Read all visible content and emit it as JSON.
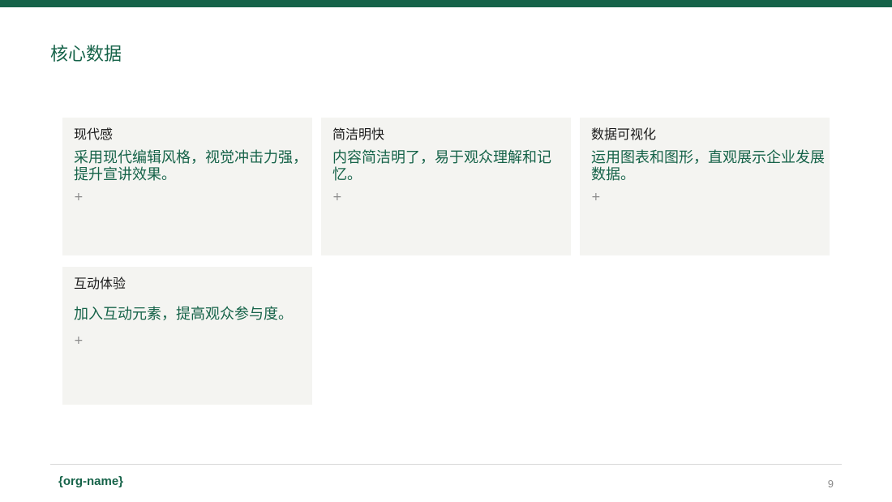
{
  "colors": {
    "accent": "#166349",
    "card_background": "#f4f4f1",
    "title_text": "#1a1a1a",
    "muted": "#8a8a8a"
  },
  "slide": {
    "title": "核心数据",
    "cards": [
      {
        "title": "现代感",
        "description": "采用现代编辑风格，视觉冲击力强，提升宣讲效果。",
        "add_icon": "plus-icon",
        "add_glyph": "+"
      },
      {
        "title": "简洁明快",
        "description": "内容简洁明了，易于观众理解和记忆。",
        "add_icon": "plus-icon",
        "add_glyph": "+"
      },
      {
        "title": "数据可视化",
        "description": "运用图表和图形，直观展示企业发展数据。",
        "add_icon": "plus-icon",
        "add_glyph": "+"
      },
      {
        "title": "互动体验",
        "description": "加入互动元素，提高观众参与度。",
        "add_icon": "plus-icon",
        "add_glyph": "+"
      }
    ]
  },
  "footer": {
    "org_name": "{org-name}",
    "page_number": "9"
  }
}
